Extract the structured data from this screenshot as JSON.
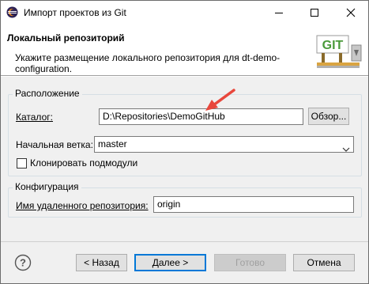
{
  "window": {
    "title": "Импорт проектов из Git"
  },
  "banner": {
    "title": "Локальный репозиторий",
    "description": "Укажите размещение локального репозитория для dt-demo-configuration.",
    "logo_text": "GIT"
  },
  "location_group": {
    "title": "Расположение",
    "directory_label": "Каталог:",
    "directory_value": "D:\\Repositories\\DemoGitHub",
    "browse_label": "Обзор...",
    "branch_label": "Начальная ветка:",
    "branch_value": "master",
    "clone_submodules_label": "Клонировать подмодули",
    "clone_submodules_checked": false
  },
  "config_group": {
    "title": "Конфигурация",
    "remote_name_label": "Имя удаленного репозитория:",
    "remote_name_value": "origin"
  },
  "footer": {
    "back_label": "< Назад",
    "next_label": "Далее >",
    "finish_label": "Готово",
    "cancel_label": "Отмена"
  },
  "colors": {
    "accent": "#0078d7",
    "arrow": "#e8473c"
  }
}
